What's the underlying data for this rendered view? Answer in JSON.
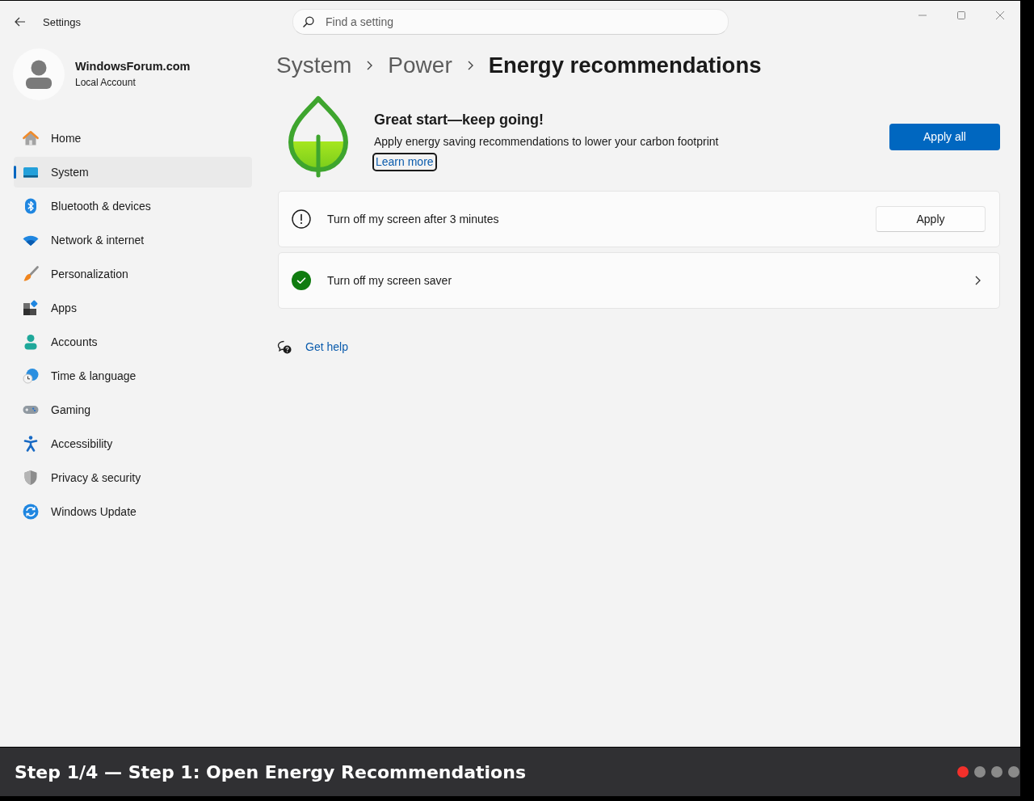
{
  "window": {
    "title": "Settings"
  },
  "search": {
    "placeholder": "Find a setting"
  },
  "profile": {
    "name": "WindowsForum.com",
    "account": "Local Account"
  },
  "sidebar": {
    "items": [
      {
        "label": "Home",
        "selected": false
      },
      {
        "label": "System",
        "selected": true
      },
      {
        "label": "Bluetooth & devices",
        "selected": false
      },
      {
        "label": "Network & internet",
        "selected": false
      },
      {
        "label": "Personalization",
        "selected": false
      },
      {
        "label": "Apps",
        "selected": false
      },
      {
        "label": "Accounts",
        "selected": false
      },
      {
        "label": "Time & language",
        "selected": false
      },
      {
        "label": "Gaming",
        "selected": false
      },
      {
        "label": "Accessibility",
        "selected": false
      },
      {
        "label": "Privacy & security",
        "selected": false
      },
      {
        "label": "Windows Update",
        "selected": false
      }
    ]
  },
  "breadcrumb": [
    {
      "label": "System"
    },
    {
      "label": "Power"
    },
    {
      "label": "Energy recommendations"
    }
  ],
  "banner": {
    "title": "Great start—keep going!",
    "description": "Apply energy saving recommendations to lower your carbon footprint",
    "link": {
      "label": "Learn more",
      "focused": true
    },
    "button": "Apply all"
  },
  "recommendations": [
    {
      "kind": "pending",
      "label": "Turn off my screen after 3 minutes",
      "button": "Apply"
    },
    {
      "kind": "applied",
      "label": "Turn off my screen saver"
    }
  ],
  "help": {
    "label": "Get help"
  },
  "caption": {
    "text": "Step 1/4 — Step 1: Open Energy Recommendations",
    "steps": [
      {
        "selected": true
      },
      {
        "selected": false
      },
      {
        "selected": false
      },
      {
        "selected": false
      }
    ]
  }
}
